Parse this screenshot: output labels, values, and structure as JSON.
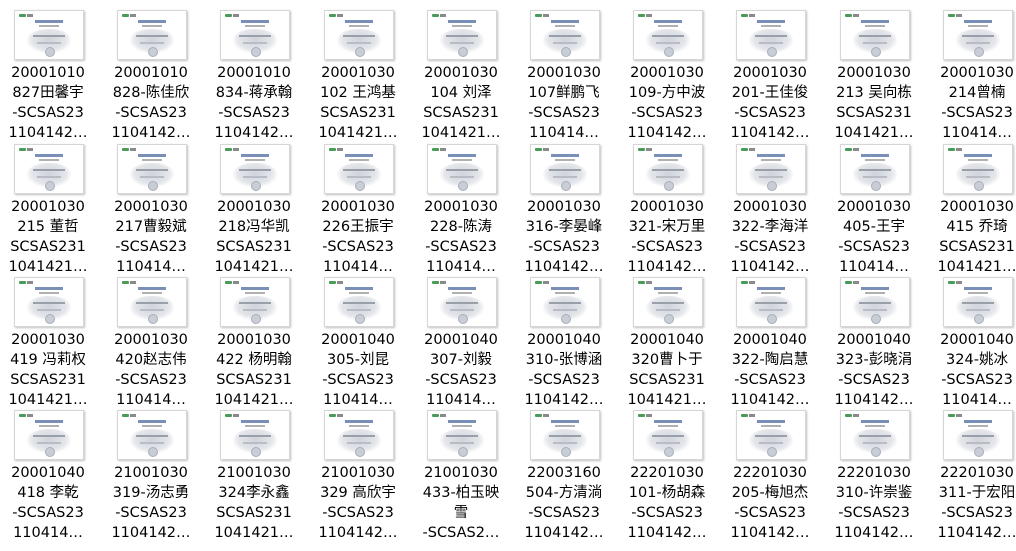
{
  "files": [
    {
      "name": "20001010\n827田馨宇\n-SCSAS23\n1104142…"
    },
    {
      "name": "20001010\n828-陈佳欣\n-SCSAS23\n1104142…"
    },
    {
      "name": "20001010\n834-蒋承翰\n-SCSAS23\n1104142…"
    },
    {
      "name": "20001030\n102 王鸿基\nSCSAS231\n1041421…"
    },
    {
      "name": "20001030\n104 刘泽\nSCSAS231\n1041421…"
    },
    {
      "name": "20001030\n107鲜鹏飞\n-SCSAS23\n110414…"
    },
    {
      "name": "20001030\n109-方中波\n-SCSAS23\n1104142…"
    },
    {
      "name": "20001030\n201-王佳俊\n-SCSAS23\n1104142…"
    },
    {
      "name": "20001030\n213 吴向栋\nSCSAS231\n1041421…"
    },
    {
      "name": "20001030\n214曾楠\n-SCSAS23\n110414…"
    },
    {
      "name": "20001030\n215 董哲\nSCSAS231\n1041421…"
    },
    {
      "name": "20001030\n217曹毅斌\n-SCSAS23\n110414…"
    },
    {
      "name": "20001030\n218冯华凯\nSCSAS231\n1041421…"
    },
    {
      "name": "20001030\n226王振宇\n-SCSAS23\n110414…"
    },
    {
      "name": "20001030\n228-陈涛\n-SCSAS23\n110414…"
    },
    {
      "name": "20001030\n316-李晏峰\n-SCSAS23\n1104142…"
    },
    {
      "name": "20001030\n321-宋万里\n-SCSAS23\n1104142…"
    },
    {
      "name": "20001030\n322-李海洋\n-SCSAS23\n1104142…"
    },
    {
      "name": "20001030\n405-王宇\n-SCSAS23\n110414…"
    },
    {
      "name": "20001030\n415 乔琦\nSCSAS231\n1041421…"
    },
    {
      "name": "20001030\n419 冯莉权\nSCSAS231\n1041421…"
    },
    {
      "name": "20001030\n420赵志伟\n-SCSAS23\n110414…"
    },
    {
      "name": "20001030\n422 杨明翰\nSCSAS231\n1041421…"
    },
    {
      "name": "20001040\n305-刘昆\n-SCSAS23\n110414…"
    },
    {
      "name": "20001040\n307-刘毅\n-SCSAS23\n110414…"
    },
    {
      "name": "20001040\n310-张博涵\n-SCSAS23\n1104142…"
    },
    {
      "name": "20001040\n320曹卜于\nSCSAS231\n1041421…"
    },
    {
      "name": "20001040\n322-陶启慧\n-SCSAS23\n1104142…"
    },
    {
      "name": "20001040\n323-彭晓涓\n-SCSAS23\n1104142…"
    },
    {
      "name": "20001040\n324-姚冰\n-SCSAS23\n110414…"
    },
    {
      "name": "20001040\n418 李乾\n-SCSAS23\n110414…"
    },
    {
      "name": "21001030\n319-汤志勇\n-SCSAS23\n1104142…"
    },
    {
      "name": "21001030\n324李永鑫\nSCSAS231\n1041421…"
    },
    {
      "name": "21001030\n329 高欣宇\n-SCSAS23\n1104142…"
    },
    {
      "name": "21001030\n433-柏玉映\n雪\n-SCSAS2…"
    },
    {
      "name": "22003160\n504-方清淌\n-SCSAS23\n1104142…"
    },
    {
      "name": "22201030\n101-杨胡森\n-SCSAS23\n1104142…"
    },
    {
      "name": "22201030\n205-梅旭杰\n-SCSAS23\n1104142…"
    },
    {
      "name": "22201030\n310-许崇鉴\n-SCSAS23\n1104142…"
    },
    {
      "name": "22201030\n311-于宏阳\n-SCSAS23\n1104142…"
    }
  ]
}
